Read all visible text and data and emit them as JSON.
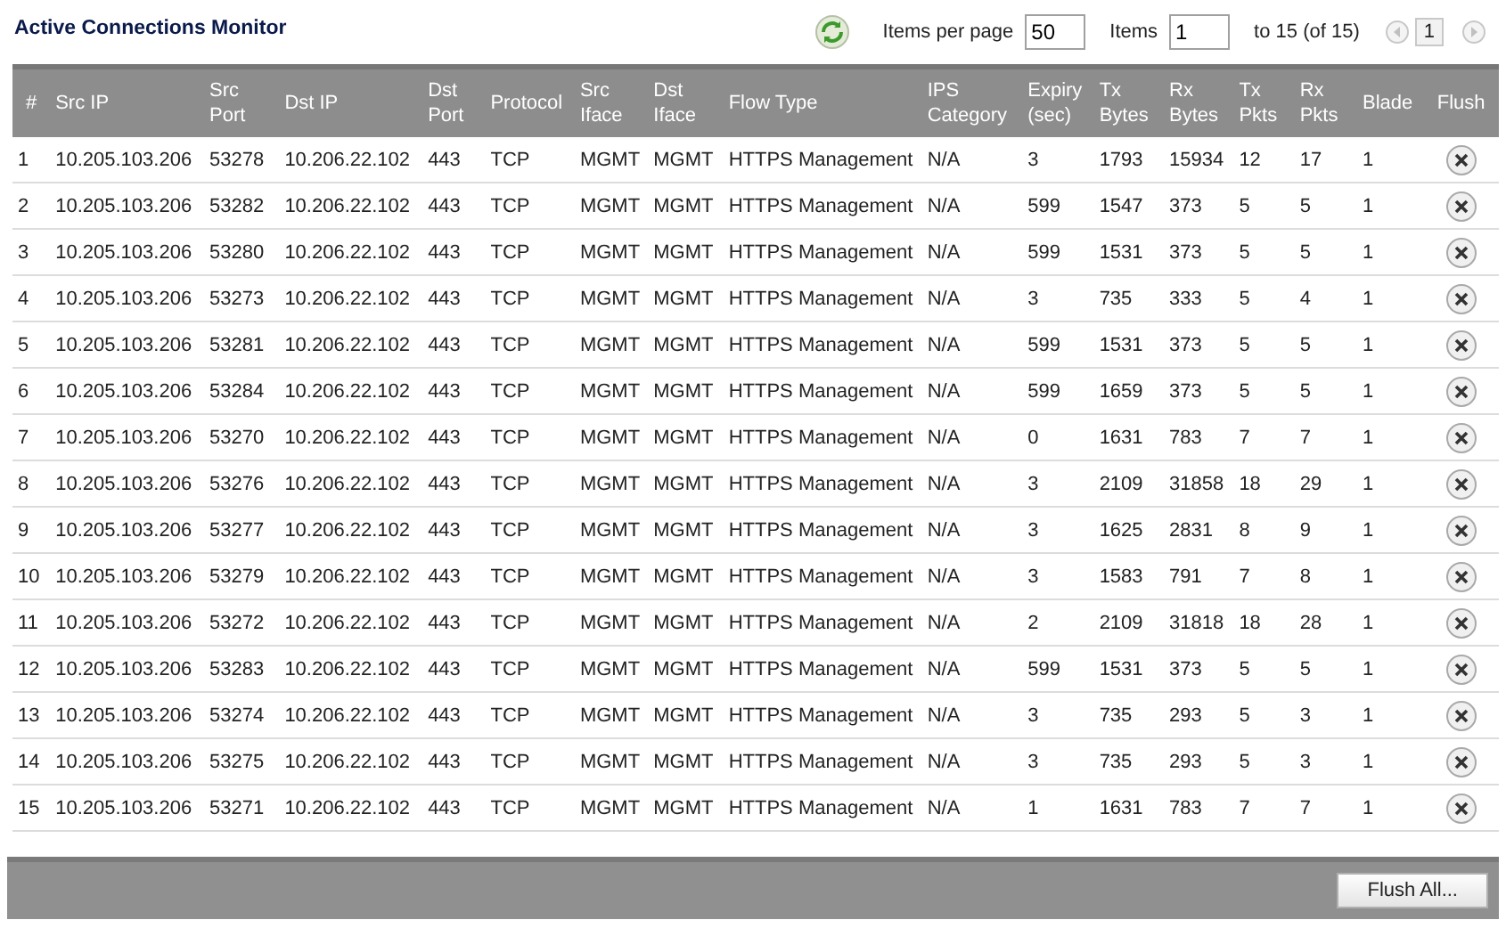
{
  "title": "Active Connections Monitor",
  "pager": {
    "items_per_page_label": "Items per page",
    "items_per_page": "50",
    "items_label": "Items",
    "items_start": "1",
    "range": "to 15 (of 15)",
    "page": "1"
  },
  "table": {
    "columns": [
      "#",
      "Src IP",
      "Src Port",
      "Dst IP",
      "Dst Port",
      "Protocol",
      "Src Iface",
      "Dst Iface",
      "Flow Type",
      "IPS Category",
      "Expiry (sec)",
      "Tx Bytes",
      "Rx Bytes",
      "Tx Pkts",
      "Rx Pkts",
      "Blade",
      "Flush"
    ],
    "rows": [
      [
        "1",
        "10.205.103.206",
        "53278",
        "10.206.22.102",
        "443",
        "TCP",
        "MGMT",
        "MGMT",
        "HTTPS Management",
        "N/A",
        "3",
        "1793",
        "15934",
        "12",
        "17",
        "1"
      ],
      [
        "2",
        "10.205.103.206",
        "53282",
        "10.206.22.102",
        "443",
        "TCP",
        "MGMT",
        "MGMT",
        "HTTPS Management",
        "N/A",
        "599",
        "1547",
        "373",
        "5",
        "5",
        "1"
      ],
      [
        "3",
        "10.205.103.206",
        "53280",
        "10.206.22.102",
        "443",
        "TCP",
        "MGMT",
        "MGMT",
        "HTTPS Management",
        "N/A",
        "599",
        "1531",
        "373",
        "5",
        "5",
        "1"
      ],
      [
        "4",
        "10.205.103.206",
        "53273",
        "10.206.22.102",
        "443",
        "TCP",
        "MGMT",
        "MGMT",
        "HTTPS Management",
        "N/A",
        "3",
        "735",
        "333",
        "5",
        "4",
        "1"
      ],
      [
        "5",
        "10.205.103.206",
        "53281",
        "10.206.22.102",
        "443",
        "TCP",
        "MGMT",
        "MGMT",
        "HTTPS Management",
        "N/A",
        "599",
        "1531",
        "373",
        "5",
        "5",
        "1"
      ],
      [
        "6",
        "10.205.103.206",
        "53284",
        "10.206.22.102",
        "443",
        "TCP",
        "MGMT",
        "MGMT",
        "HTTPS Management",
        "N/A",
        "599",
        "1659",
        "373",
        "5",
        "5",
        "1"
      ],
      [
        "7",
        "10.205.103.206",
        "53270",
        "10.206.22.102",
        "443",
        "TCP",
        "MGMT",
        "MGMT",
        "HTTPS Management",
        "N/A",
        "0",
        "1631",
        "783",
        "7",
        "7",
        "1"
      ],
      [
        "8",
        "10.205.103.206",
        "53276",
        "10.206.22.102",
        "443",
        "TCP",
        "MGMT",
        "MGMT",
        "HTTPS Management",
        "N/A",
        "3",
        "2109",
        "31858",
        "18",
        "29",
        "1"
      ],
      [
        "9",
        "10.205.103.206",
        "53277",
        "10.206.22.102",
        "443",
        "TCP",
        "MGMT",
        "MGMT",
        "HTTPS Management",
        "N/A",
        "3",
        "1625",
        "2831",
        "8",
        "9",
        "1"
      ],
      [
        "10",
        "10.205.103.206",
        "53279",
        "10.206.22.102",
        "443",
        "TCP",
        "MGMT",
        "MGMT",
        "HTTPS Management",
        "N/A",
        "3",
        "1583",
        "791",
        "7",
        "8",
        "1"
      ],
      [
        "11",
        "10.205.103.206",
        "53272",
        "10.206.22.102",
        "443",
        "TCP",
        "MGMT",
        "MGMT",
        "HTTPS Management",
        "N/A",
        "2",
        "2109",
        "31818",
        "18",
        "28",
        "1"
      ],
      [
        "12",
        "10.205.103.206",
        "53283",
        "10.206.22.102",
        "443",
        "TCP",
        "MGMT",
        "MGMT",
        "HTTPS Management",
        "N/A",
        "599",
        "1531",
        "373",
        "5",
        "5",
        "1"
      ],
      [
        "13",
        "10.205.103.206",
        "53274",
        "10.206.22.102",
        "443",
        "TCP",
        "MGMT",
        "MGMT",
        "HTTPS Management",
        "N/A",
        "3",
        "735",
        "293",
        "5",
        "3",
        "1"
      ],
      [
        "14",
        "10.205.103.206",
        "53275",
        "10.206.22.102",
        "443",
        "TCP",
        "MGMT",
        "MGMT",
        "HTTPS Management",
        "N/A",
        "3",
        "735",
        "293",
        "5",
        "3",
        "1"
      ],
      [
        "15",
        "10.205.103.206",
        "53271",
        "10.206.22.102",
        "443",
        "TCP",
        "MGMT",
        "MGMT",
        "HTTPS Management",
        "N/A",
        "1",
        "1631",
        "783",
        "7",
        "7",
        "1"
      ]
    ]
  },
  "footer": {
    "button": "Flush All..."
  }
}
